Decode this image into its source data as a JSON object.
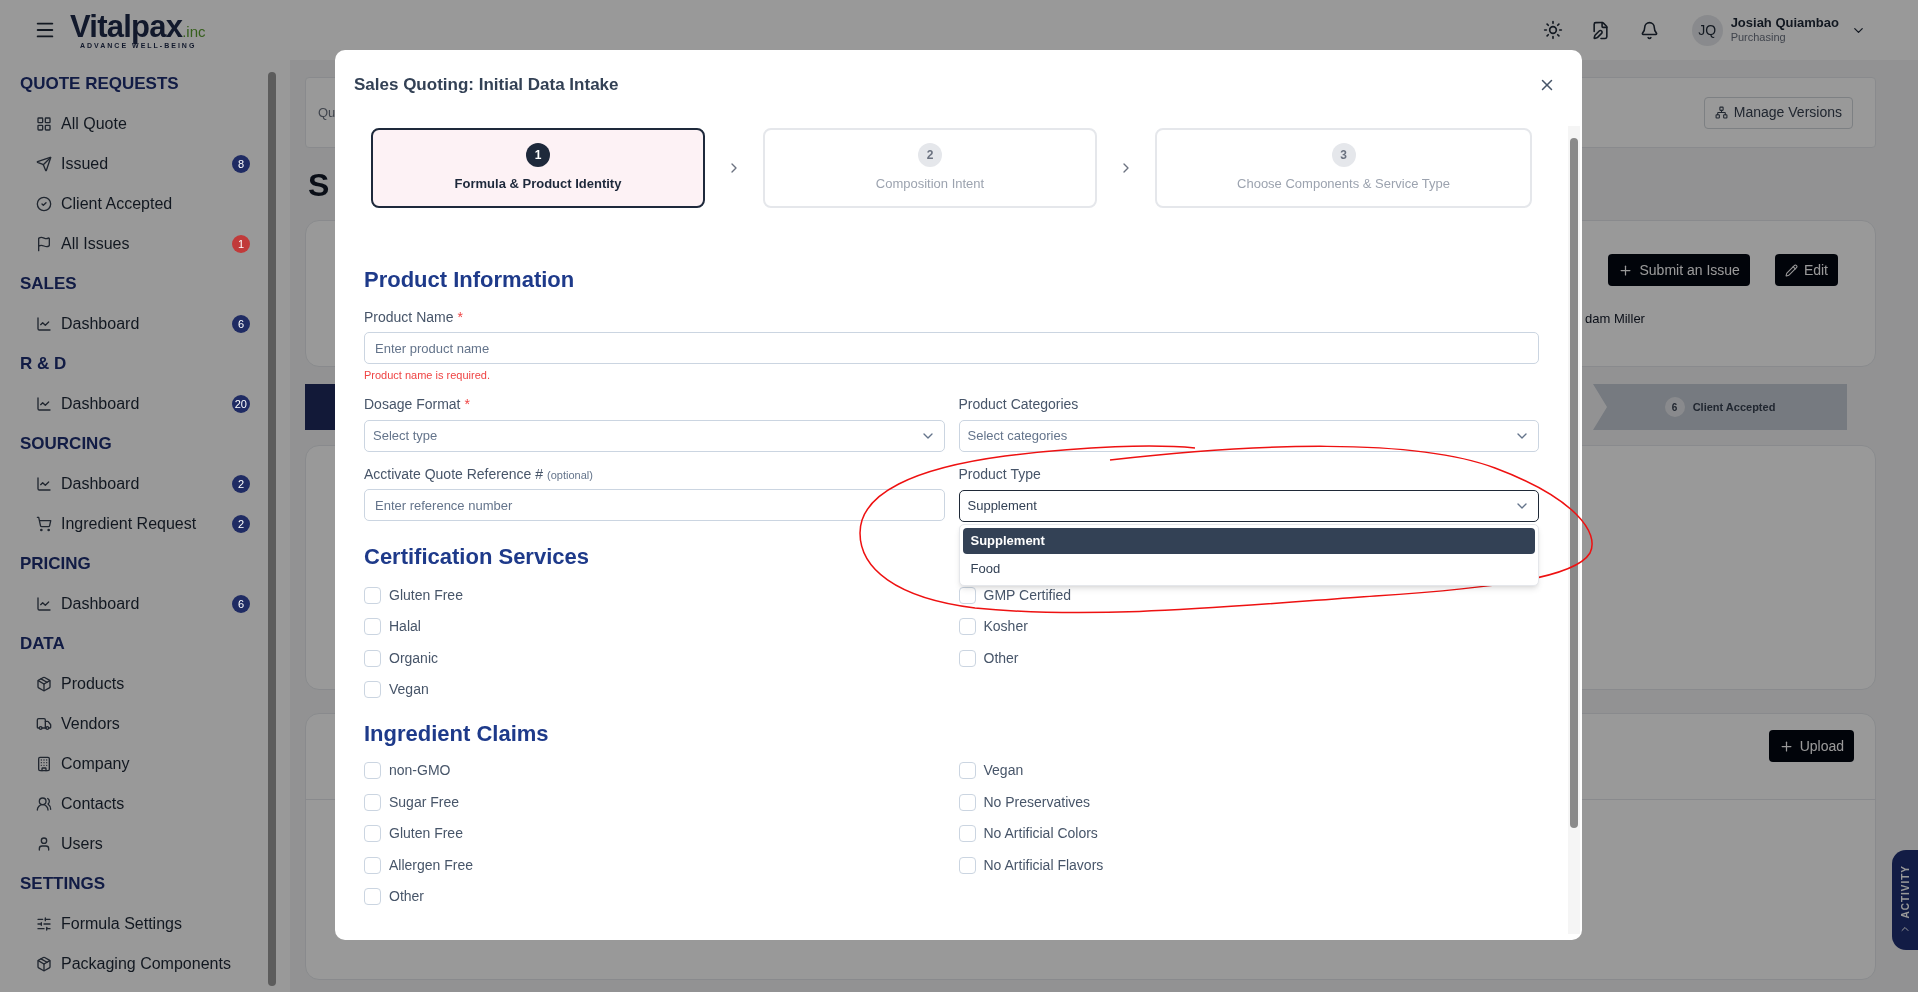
{
  "header": {
    "logo": {
      "name": "Vitalpax",
      "suffix": ".inc",
      "tagline": "ADVANCE WELL-BEING"
    },
    "user": {
      "initials": "JQ",
      "name": "Josiah Quiambao",
      "role": "Purchasing"
    }
  },
  "sidebar": {
    "sections": [
      {
        "title": "QUOTE REQUESTS",
        "items": [
          {
            "label": "All Quote"
          },
          {
            "label": "Issued",
            "badge": "8",
            "color": "#1f2b63"
          },
          {
            "label": "Client Accepted"
          },
          {
            "label": "All Issues",
            "badge": "1",
            "color": "#c13a3a"
          }
        ]
      },
      {
        "title": "SALES",
        "items": [
          {
            "label": "Dashboard",
            "badge": "6",
            "color": "#1f2b63"
          }
        ]
      },
      {
        "title": "R & D",
        "items": [
          {
            "label": "Dashboard",
            "badge": "20",
            "color": "#1f2b63"
          }
        ]
      },
      {
        "title": "SOURCING",
        "items": [
          {
            "label": "Dashboard",
            "badge": "2",
            "color": "#1f2b63"
          },
          {
            "label": "Ingredient Request",
            "badge": "2",
            "color": "#1f2b63"
          }
        ]
      },
      {
        "title": "PRICING",
        "items": [
          {
            "label": "Dashboard",
            "badge": "6",
            "color": "#1f2b63"
          }
        ]
      },
      {
        "title": "DATA",
        "items": [
          {
            "label": "Products"
          },
          {
            "label": "Vendors"
          },
          {
            "label": "Company"
          },
          {
            "label": "Contacts"
          },
          {
            "label": "Users"
          }
        ]
      },
      {
        "title": "SETTINGS",
        "items": [
          {
            "label": "Formula Settings"
          },
          {
            "label": "Packaging Components"
          }
        ]
      }
    ]
  },
  "background": {
    "breadcrumb": "Qu",
    "manage_versions": "Manage Versions",
    "heading": "S",
    "submit_issue": "Submit an Issue",
    "edit": "Edit",
    "assignee": "dam Miller",
    "progress_step": {
      "number": "6",
      "label": "Client Accepted"
    },
    "upload": "Upload",
    "activity": "ACTIVITY"
  },
  "modal": {
    "title": "Sales Quoting: Initial Data Intake",
    "steps": [
      {
        "number": "1",
        "label": "Formula & Product Identity",
        "selected": true
      },
      {
        "number": "2",
        "label": "Composition Intent",
        "selected": false
      },
      {
        "number": "3",
        "label": "Choose Components & Service Type",
        "selected": false
      }
    ],
    "product_info": {
      "heading": "Product Information",
      "fields": [
        {
          "kind": "input",
          "label": "Product Name",
          "required_marker": "*",
          "placeholder": "Enter product name",
          "error": "Product name is required."
        },
        {
          "kind": "select",
          "label": "Dosage Format",
          "required_marker": "*",
          "placeholder": "Select type"
        },
        {
          "kind": "select",
          "label": "Product Categories",
          "placeholder": "Select categories"
        },
        {
          "kind": "input",
          "label": "Acctivate Quote Reference #",
          "hint": "(optional)",
          "placeholder": "Enter reference number"
        },
        {
          "kind": "select",
          "label": "Product Type",
          "value": "Supplement",
          "expanded": true,
          "options": [
            {
              "label": "Supplement",
              "selected": true
            },
            {
              "label": "Food",
              "selected": false
            }
          ]
        }
      ]
    },
    "certification": {
      "heading": "Certification Services",
      "options": [
        {
          "label": "Gluten Free",
          "checked": false
        },
        {
          "label": "GMP Certified",
          "checked": false
        },
        {
          "label": "Halal",
          "checked": false
        },
        {
          "label": "Kosher",
          "checked": false
        },
        {
          "label": "Organic",
          "checked": false
        },
        {
          "label": "Other",
          "checked": false
        },
        {
          "label": "Vegan",
          "checked": false
        }
      ]
    },
    "claims": {
      "heading": "Ingredient Claims",
      "options": [
        {
          "label": "non-GMO",
          "checked": false
        },
        {
          "label": "Vegan",
          "checked": false
        },
        {
          "label": "Sugar Free",
          "checked": false
        },
        {
          "label": "No Preservatives",
          "checked": false
        },
        {
          "label": "Gluten Free",
          "checked": false
        },
        {
          "label": "No Artificial Colors",
          "checked": false
        },
        {
          "label": "Allergen Free",
          "checked": false
        },
        {
          "label": "No Artificial Flavors",
          "checked": false
        },
        {
          "label": "Other",
          "checked": false
        }
      ]
    }
  }
}
